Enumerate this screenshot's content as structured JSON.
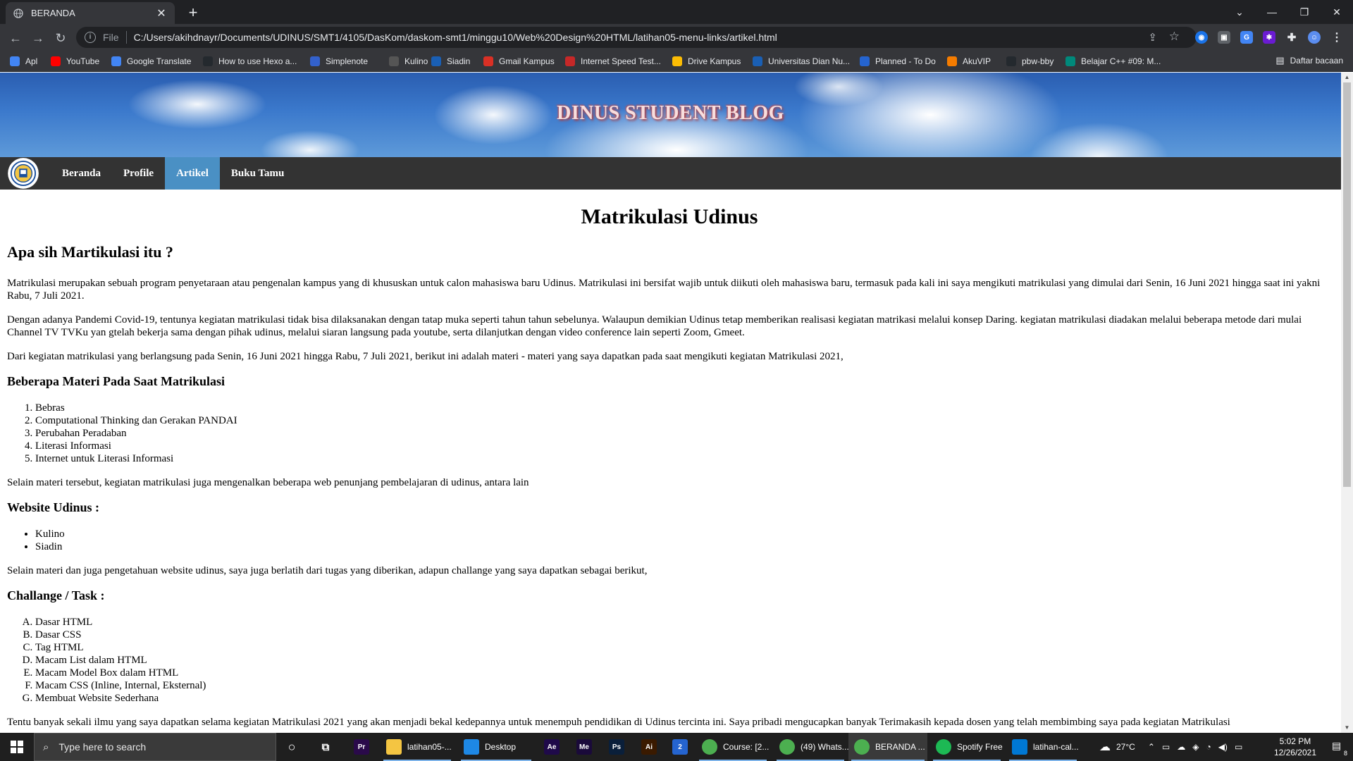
{
  "browser": {
    "tab_title": "BERANDA",
    "url_scheme": "File",
    "url": "C:/Users/akihdnayr/Documents/UDINUS/SMT1/4105/DasKom/daskom-smt1/minggu10/Web%20Design%20HTML/latihan05-menu-links/artikel.html",
    "bookmarks": [
      {
        "label": "Apl",
        "icon": "apps-grid-icon",
        "color": "#4285f4"
      },
      {
        "label": "YouTube",
        "icon": "youtube-icon",
        "color": "#ff0000"
      },
      {
        "label": "Google Translate",
        "icon": "translate-icon",
        "color": "#4285f4"
      },
      {
        "label": "How to use Hexo a...",
        "icon": "github-icon",
        "color": "#24292e"
      },
      {
        "label": "Simplenote",
        "icon": "simplenote-icon",
        "color": "#3361cc"
      },
      {
        "label": "Kulino",
        "icon": "kulino-icon",
        "color": "#555555"
      },
      {
        "label": "Siadin",
        "icon": "siadin-icon",
        "color": "#1a5fb4"
      },
      {
        "label": "Gmail Kampus",
        "icon": "gmail-icon",
        "color": "#d93025"
      },
      {
        "label": "Internet Speed Test...",
        "icon": "speedtest-icon",
        "color": "#c62828"
      },
      {
        "label": "Drive Kampus",
        "icon": "drive-icon",
        "color": "#fbbc04"
      },
      {
        "label": "Universitas Dian Nu...",
        "icon": "udinus-icon",
        "color": "#1a5fb4"
      },
      {
        "label": "Planned - To Do",
        "icon": "todo-icon",
        "color": "#2564cf"
      },
      {
        "label": "AkuVIP",
        "icon": "akuvip-icon",
        "color": "#f57c00"
      },
      {
        "label": "pbw-bby",
        "icon": "github-icon",
        "color": "#24292e"
      },
      {
        "label": "Belajar C++ #09: M...",
        "icon": "petani-kode-icon",
        "color": "#00897b"
      }
    ],
    "reading_list": "Daftar bacaan"
  },
  "site": {
    "banner_title": "DINUS STUDENT BLOG",
    "nav": [
      "Beranda",
      "Profile",
      "Artikel",
      "Buku Tamu"
    ],
    "active_nav": "Artikel"
  },
  "article": {
    "heading": "Matrikulasi Udinus",
    "subheading": "Apa sih Martikulasi itu ?",
    "p1": "Matrikulasi merupakan sebuah program penyetaraan atau pengenalan kampus yang di khususkan untuk calon mahasiswa baru Udinus. Matrikulasi ini bersifat wajib untuk diikuti oleh mahasiswa baru, termasuk pada kali ini saya mengikuti matrikulasi yang dimulai dari Senin, 16 Juni 2021 hingga saat ini yakni Rabu, 7 Juli 2021.",
    "p2": "Dengan adanya Pandemi Covid-19, tentunya kegiatan matrikulasi tidak bisa dilaksanakan dengan tatap muka seperti tahun tahun sebelunya. Walaupun demikian Udinus tetap memberikan realisasi kegiatan matrikasi melalui konsep Daring. kegiatan matrikulasi diadakan melalui beberapa metode dari mulai Channel TV TVKu yan gtelah bekerja sama dengan pihak udinus, melalui siaran langsung pada youtube, serta dilanjutkan dengan video conference lain seperti Zoom, Gmeet.",
    "p3": "Dari kegiatan matrikulasi yang berlangsung pada Senin, 16 Juni 2021 hingga Rabu, 7 Juli 2021, berikut ini adalah materi - materi yang saya dapatkan pada saat mengikuti kegiatan Matrikulasi 2021,",
    "materi_heading": "Beberapa Materi Pada Saat Matrikulasi",
    "materi": [
      "Bebras",
      "Computational Thinking dan Gerakan PANDAI",
      "Perubahan Peradaban",
      "Literasi Informasi",
      "Internet untuk Literasi Informasi"
    ],
    "p4": "Selain materi tersebut, kegiatan matrikulasi juga mengenalkan beberapa web penunjang pembelajaran di udinus, antara lain",
    "website_heading": "Website Udinus :",
    "websites": [
      "Kulino",
      "Siadin"
    ],
    "p5": "Selain materi dan juga pengetahuan website udinus, saya juga berlatih dari tugas yang diberikan, adapun challange yang saya dapatkan sebagai berikut,",
    "task_heading": "Challange / Task :",
    "tasks": [
      "Dasar HTML",
      "Dasar CSS",
      "Tag HTML",
      "Macam List dalam HTML",
      "Macam Model Box dalam HTML",
      "Macam CSS (Inline, Internal, Eksternal)",
      "Membuat Website Sederhana"
    ],
    "p6": "Tentu banyak sekali ilmu yang saya dapatkan selama kegiatan Matrikulasi 2021 yang akan menjadi bekal kedepannya untuk menempuh pendidikan di Udinus tercinta ini. Saya pribadi mengucapkan banyak Terimakasih kepada dosen yang telah membimbing saya pada kegiatan Matrikulasi"
  },
  "taskbar": {
    "search_placeholder": "Type here to search",
    "apps": [
      {
        "label": "",
        "icon": "premiere-icon",
        "color": "#2a0a4a",
        "text": "Pr"
      },
      {
        "label": "latihan05-...",
        "icon": "folder-icon",
        "color": "#f4c542",
        "text": ""
      },
      {
        "label": "Desktop",
        "icon": "desktop-icon",
        "color": "#1e88e5",
        "text": ""
      },
      {
        "label": "",
        "icon": "after-effects-icon",
        "color": "#1f0a4a",
        "text": "Ae"
      },
      {
        "label": "",
        "icon": "media-encoder-icon",
        "color": "#1a0a3a",
        "text": "Me"
      },
      {
        "label": "",
        "icon": "photoshop-icon",
        "color": "#0a1f3a",
        "text": "Ps"
      },
      {
        "label": "",
        "icon": "illustrator-icon",
        "color": "#3a1a00",
        "text": "Ai"
      },
      {
        "label": "",
        "icon": "todo-app-icon",
        "color": "#2564cf",
        "text": "2"
      },
      {
        "label": "Course: [2...",
        "icon": "chrome-icon",
        "color": "#4caf50",
        "text": ""
      },
      {
        "label": "(49) Whats...",
        "icon": "chrome-icon",
        "color": "#4caf50",
        "text": ""
      },
      {
        "label": "BERANDA ...",
        "icon": "chrome-icon",
        "color": "#4caf50",
        "text": ""
      },
      {
        "label": "Spotify Free",
        "icon": "spotify-icon",
        "color": "#1db954",
        "text": ""
      },
      {
        "label": "latihan-cal...",
        "icon": "vscode-icon",
        "color": "#0078d4",
        "text": ""
      }
    ],
    "weather": "27°C",
    "time": "5:02 PM",
    "date": "12/26/2021",
    "notification_count": "8"
  }
}
